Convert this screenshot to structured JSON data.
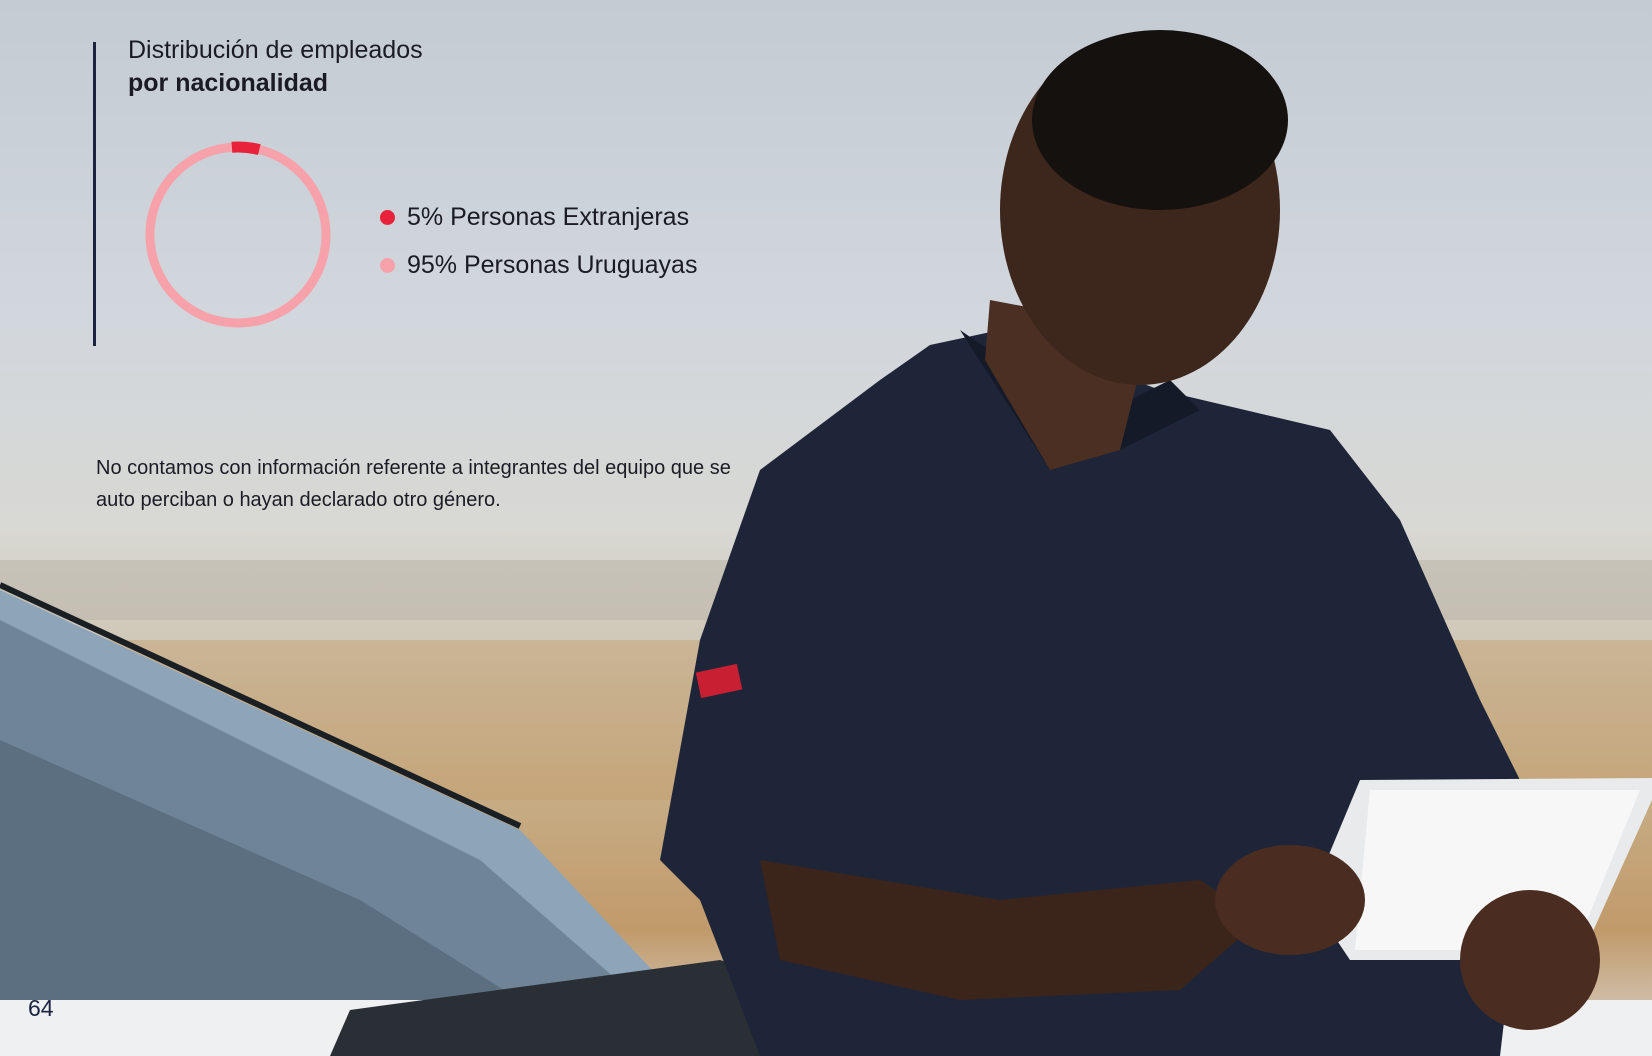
{
  "title": {
    "line1": "Distribución de empleados",
    "line2": "por nacionalidad"
  },
  "chart_data": {
    "type": "pie",
    "categories": [
      "Personas Extranjeras",
      "Personas Uruguayas"
    ],
    "values": [
      5,
      95
    ],
    "colors": [
      "#e8223a",
      "#f7a1aa"
    ],
    "legend_position": "right"
  },
  "legend": [
    {
      "label": "5% Personas Extranjeras",
      "color": "#e8223a"
    },
    {
      "label": "95% Personas Uruguayas",
      "color": "#f7a1aa"
    }
  ],
  "note": "No contamos con información referente a integrantes del equipo que se auto perciban o hayan declarado otro género.",
  "page_number": "64",
  "photo": {
    "description": "person-with-tablet-icon"
  }
}
